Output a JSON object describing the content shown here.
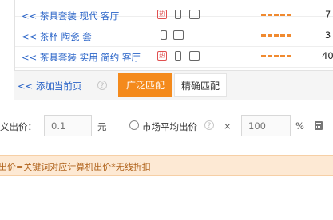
{
  "keyword_rows": [
    {
      "link": "",
      "count": "",
      "hot": false
    },
    {
      "link": "<< 茶具套装 现代 客厅",
      "count": "7",
      "hot": true
    },
    {
      "link": "<< 茶杯 陶瓷 套",
      "count": "3",
      "hot": false
    },
    {
      "link": "<< 茶具套装 实用 简约 客厅",
      "count": "40",
      "hot": true
    }
  ],
  "tags": {
    "hot": "热",
    "phone": "",
    "pc": "PC"
  },
  "toolbar": {
    "add_page_link": "<< 添加当前页",
    "help_icon": "?",
    "match_wide": "广泛匹配",
    "match_exact": "精确匹配"
  },
  "bid": {
    "label": "义出价：",
    "value_placeholder": "0.1",
    "unit": "元",
    "avg_label": "市场平均出价",
    "multiply": "×",
    "percent_placeholder": "100",
    "percent_unit": "%"
  },
  "notice": {
    "text": "出价=关键词对应计算机出价*无线折扣"
  },
  "colors": {
    "accent": "#f48a1c",
    "link": "#2a64c8",
    "notice_bg": "#fde9d4",
    "notice_text": "#b0631c"
  }
}
